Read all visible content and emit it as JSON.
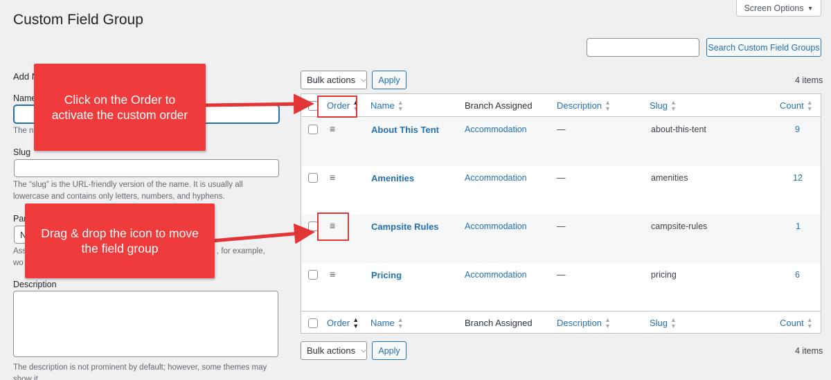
{
  "page": {
    "title": "Custom Field Group",
    "screen_options": "Screen Options"
  },
  "search": {
    "button": "Search Custom Field Groups",
    "value": ""
  },
  "form": {
    "add_label": "Add N",
    "name_label": "Name",
    "name_help": "The na",
    "slug_label": "Slug",
    "slug_help_1": "The “slug” is the URL-friendly version of the name. It is usually all",
    "slug_help_2": "lowercase and contains only letters, numbers, and hyphens.",
    "parent_label": "Par",
    "parent_value": "N",
    "parent_help_1": "Ass",
    "parent_help_1b": ", for example,",
    "parent_help_2": "wo",
    "description_label": "Description",
    "description_help_1": "The description is not prominent by default; however, some themes may",
    "description_help_2": "show it."
  },
  "toolbar": {
    "bulk_actions": "Bulk actions",
    "apply": "Apply",
    "items_count": "4 items"
  },
  "table": {
    "columns": {
      "order": "Order",
      "name": "Name",
      "branch": "Branch Assigned",
      "description": "Description",
      "slug": "Slug",
      "count": "Count"
    },
    "rows": [
      {
        "name": "About This Tent",
        "branch": "Accommodation",
        "description": "—",
        "slug": "about-this-tent",
        "count": "9"
      },
      {
        "name": "Amenities",
        "branch": "Accommodation",
        "description": "—",
        "slug": "amenities",
        "count": "12"
      },
      {
        "name": "Campsite Rules",
        "branch": "Accommodation",
        "description": "—",
        "slug": "campsite-rules",
        "count": "1"
      },
      {
        "name": "Pricing",
        "branch": "Accommodation",
        "description": "—",
        "slug": "pricing",
        "count": "6"
      }
    ]
  },
  "annotations": {
    "callout_1_line_1": "Click on the Order to",
    "callout_1_line_2": "activate the custom order",
    "callout_2_line_1": "Drag & drop the icon to move",
    "callout_2_line_2": "the field group"
  },
  "colors": {
    "accent": "#2271b1",
    "callout": "#ef3b3b",
    "highlight": "#e23636"
  },
  "icons": {
    "sort": "sort-arrows-icon",
    "drag": "drag-handle-icon",
    "dropdown": "chevron-down-icon"
  }
}
